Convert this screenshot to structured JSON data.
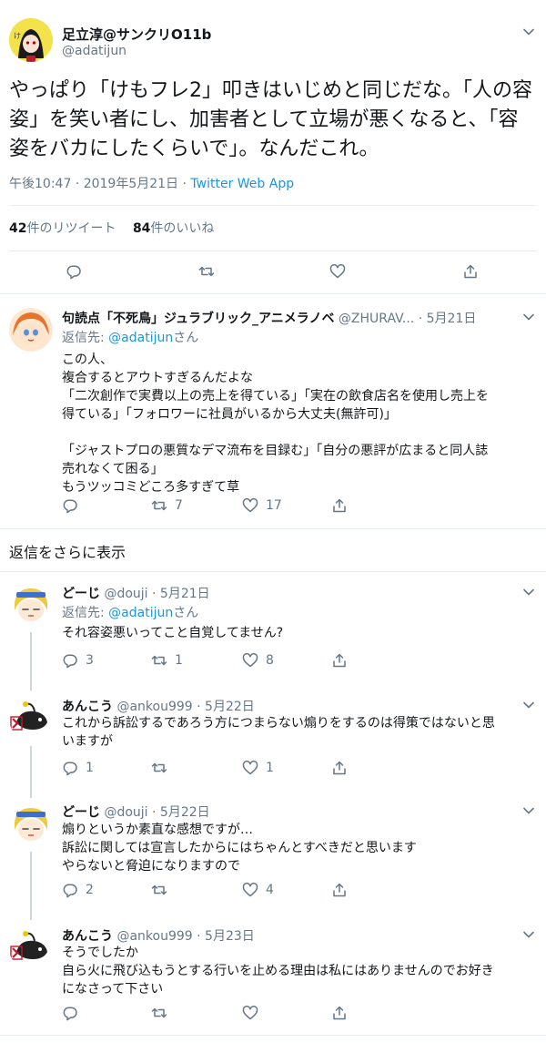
{
  "main": {
    "name": "足立淳@サンクリO11b",
    "handle": "@adatijun",
    "text": "やっぱり「けもフレ2」叩きはいじめと同じだな。「人の容姿」を笑い者にし、加害者として立場が悪くなると、「容姿をバカにしたくらいで」。なんだこれ。",
    "time": "午後10:47 · 2019年5月21日 · ",
    "source": "Twitter Web App",
    "retweet_count": "42",
    "retweet_label": "件のリツイート",
    "like_count": "84",
    "like_label": "件のいいね"
  },
  "reply_prefix": "返信先: ",
  "reply_suffix": "さん",
  "show_more": "返信をさらに表示",
  "replies": [
    {
      "name": "句読点「不死鳥」ジュラブリック_アニメラノベ",
      "handle": "@ZHURAV...",
      "date": "5月21日",
      "reply_to": "@adatijun",
      "lines": [
        "この人、",
        "複合するとアウトすぎるんだよな",
        "「二次創作で実費以上の売上を得ている」「実在の飲食店名を使用し売上を",
        "得ている」「フォロワーに社員がいるから大丈夫(無許可)」",
        "",
        "「ジャストプロの悪質なデマ流布を目録む」「自分の悪評が広まると同人誌",
        "売れなくて困る」",
        "もうツッコミどころ多すぎて草"
      ],
      "reply_count": "",
      "retweet_count": "7",
      "like_count": "17"
    },
    {
      "name": "どーじ",
      "handle": "@douji",
      "date": "5月21日",
      "reply_to": "@adatijun",
      "lines": [
        "それ容姿悪いってこと自覚してません?"
      ],
      "reply_count": "3",
      "retweet_count": "1",
      "like_count": "8"
    },
    {
      "name": "あんこう",
      "handle": "@ankou999",
      "date": "5月22日",
      "lines": [
        "これから訴訟するであろう方につまらない煽りをするのは得策ではないと思",
        "いますが"
      ],
      "reply_count": "1",
      "retweet_count": "",
      "like_count": "1"
    },
    {
      "name": "どーじ",
      "handle": "@douji",
      "date": "5月22日",
      "lines": [
        "煽りというか素直な感想ですが…",
        "訴訟に関しては宣言したからにはちゃんとすべきだと思います",
        "やらないと脅迫になりますので"
      ],
      "reply_count": "2",
      "retweet_count": "",
      "like_count": "4"
    },
    {
      "name": "あんこう",
      "handle": "@ankou999",
      "date": "5月23日",
      "lines": [
        "そうでしたか",
        "自ら火に飛び込もうとする行いを止める理由は私にはありませんのでお好き",
        "になさって下さい"
      ],
      "reply_count": "",
      "retweet_count": "",
      "like_count": ""
    }
  ]
}
